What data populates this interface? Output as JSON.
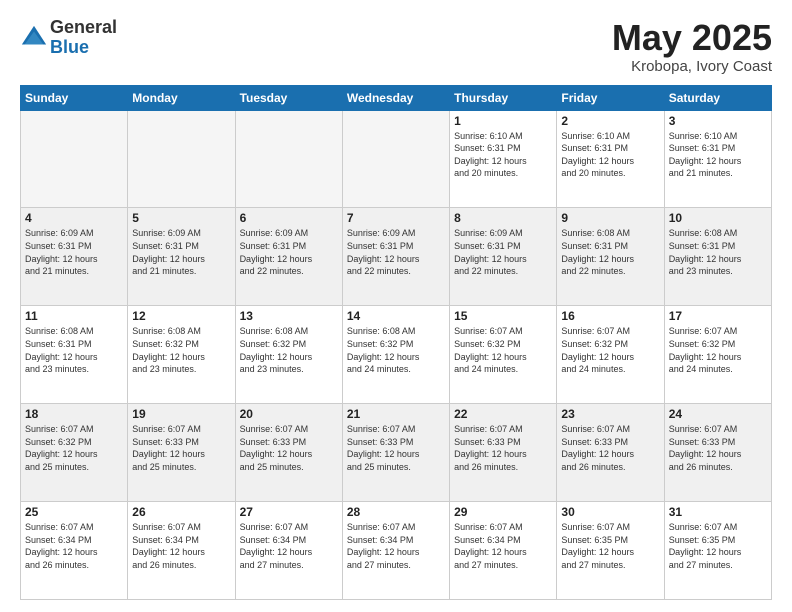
{
  "logo": {
    "general": "General",
    "blue": "Blue"
  },
  "title": "May 2025",
  "location": "Krobopa, Ivory Coast",
  "days_header": [
    "Sunday",
    "Monday",
    "Tuesday",
    "Wednesday",
    "Thursday",
    "Friday",
    "Saturday"
  ],
  "weeks": [
    [
      {
        "day": "",
        "text": "",
        "empty": true
      },
      {
        "day": "",
        "text": "",
        "empty": true
      },
      {
        "day": "",
        "text": "",
        "empty": true
      },
      {
        "day": "",
        "text": "",
        "empty": true
      },
      {
        "day": "1",
        "text": "Sunrise: 6:10 AM\nSunset: 6:31 PM\nDaylight: 12 hours\nand 20 minutes.",
        "empty": false
      },
      {
        "day": "2",
        "text": "Sunrise: 6:10 AM\nSunset: 6:31 PM\nDaylight: 12 hours\nand 20 minutes.",
        "empty": false
      },
      {
        "day": "3",
        "text": "Sunrise: 6:10 AM\nSunset: 6:31 PM\nDaylight: 12 hours\nand 21 minutes.",
        "empty": false
      }
    ],
    [
      {
        "day": "4",
        "text": "Sunrise: 6:09 AM\nSunset: 6:31 PM\nDaylight: 12 hours\nand 21 minutes.",
        "empty": false
      },
      {
        "day": "5",
        "text": "Sunrise: 6:09 AM\nSunset: 6:31 PM\nDaylight: 12 hours\nand 21 minutes.",
        "empty": false
      },
      {
        "day": "6",
        "text": "Sunrise: 6:09 AM\nSunset: 6:31 PM\nDaylight: 12 hours\nand 22 minutes.",
        "empty": false
      },
      {
        "day": "7",
        "text": "Sunrise: 6:09 AM\nSunset: 6:31 PM\nDaylight: 12 hours\nand 22 minutes.",
        "empty": false
      },
      {
        "day": "8",
        "text": "Sunrise: 6:09 AM\nSunset: 6:31 PM\nDaylight: 12 hours\nand 22 minutes.",
        "empty": false
      },
      {
        "day": "9",
        "text": "Sunrise: 6:08 AM\nSunset: 6:31 PM\nDaylight: 12 hours\nand 22 minutes.",
        "empty": false
      },
      {
        "day": "10",
        "text": "Sunrise: 6:08 AM\nSunset: 6:31 PM\nDaylight: 12 hours\nand 23 minutes.",
        "empty": false
      }
    ],
    [
      {
        "day": "11",
        "text": "Sunrise: 6:08 AM\nSunset: 6:31 PM\nDaylight: 12 hours\nand 23 minutes.",
        "empty": false
      },
      {
        "day": "12",
        "text": "Sunrise: 6:08 AM\nSunset: 6:32 PM\nDaylight: 12 hours\nand 23 minutes.",
        "empty": false
      },
      {
        "day": "13",
        "text": "Sunrise: 6:08 AM\nSunset: 6:32 PM\nDaylight: 12 hours\nand 23 minutes.",
        "empty": false
      },
      {
        "day": "14",
        "text": "Sunrise: 6:08 AM\nSunset: 6:32 PM\nDaylight: 12 hours\nand 24 minutes.",
        "empty": false
      },
      {
        "day": "15",
        "text": "Sunrise: 6:07 AM\nSunset: 6:32 PM\nDaylight: 12 hours\nand 24 minutes.",
        "empty": false
      },
      {
        "day": "16",
        "text": "Sunrise: 6:07 AM\nSunset: 6:32 PM\nDaylight: 12 hours\nand 24 minutes.",
        "empty": false
      },
      {
        "day": "17",
        "text": "Sunrise: 6:07 AM\nSunset: 6:32 PM\nDaylight: 12 hours\nand 24 minutes.",
        "empty": false
      }
    ],
    [
      {
        "day": "18",
        "text": "Sunrise: 6:07 AM\nSunset: 6:32 PM\nDaylight: 12 hours\nand 25 minutes.",
        "empty": false
      },
      {
        "day": "19",
        "text": "Sunrise: 6:07 AM\nSunset: 6:33 PM\nDaylight: 12 hours\nand 25 minutes.",
        "empty": false
      },
      {
        "day": "20",
        "text": "Sunrise: 6:07 AM\nSunset: 6:33 PM\nDaylight: 12 hours\nand 25 minutes.",
        "empty": false
      },
      {
        "day": "21",
        "text": "Sunrise: 6:07 AM\nSunset: 6:33 PM\nDaylight: 12 hours\nand 25 minutes.",
        "empty": false
      },
      {
        "day": "22",
        "text": "Sunrise: 6:07 AM\nSunset: 6:33 PM\nDaylight: 12 hours\nand 26 minutes.",
        "empty": false
      },
      {
        "day": "23",
        "text": "Sunrise: 6:07 AM\nSunset: 6:33 PM\nDaylight: 12 hours\nand 26 minutes.",
        "empty": false
      },
      {
        "day": "24",
        "text": "Sunrise: 6:07 AM\nSunset: 6:33 PM\nDaylight: 12 hours\nand 26 minutes.",
        "empty": false
      }
    ],
    [
      {
        "day": "25",
        "text": "Sunrise: 6:07 AM\nSunset: 6:34 PM\nDaylight: 12 hours\nand 26 minutes.",
        "empty": false
      },
      {
        "day": "26",
        "text": "Sunrise: 6:07 AM\nSunset: 6:34 PM\nDaylight: 12 hours\nand 26 minutes.",
        "empty": false
      },
      {
        "day": "27",
        "text": "Sunrise: 6:07 AM\nSunset: 6:34 PM\nDaylight: 12 hours\nand 27 minutes.",
        "empty": false
      },
      {
        "day": "28",
        "text": "Sunrise: 6:07 AM\nSunset: 6:34 PM\nDaylight: 12 hours\nand 27 minutes.",
        "empty": false
      },
      {
        "day": "29",
        "text": "Sunrise: 6:07 AM\nSunset: 6:34 PM\nDaylight: 12 hours\nand 27 minutes.",
        "empty": false
      },
      {
        "day": "30",
        "text": "Sunrise: 6:07 AM\nSunset: 6:35 PM\nDaylight: 12 hours\nand 27 minutes.",
        "empty": false
      },
      {
        "day": "31",
        "text": "Sunrise: 6:07 AM\nSunset: 6:35 PM\nDaylight: 12 hours\nand 27 minutes.",
        "empty": false
      }
    ]
  ]
}
